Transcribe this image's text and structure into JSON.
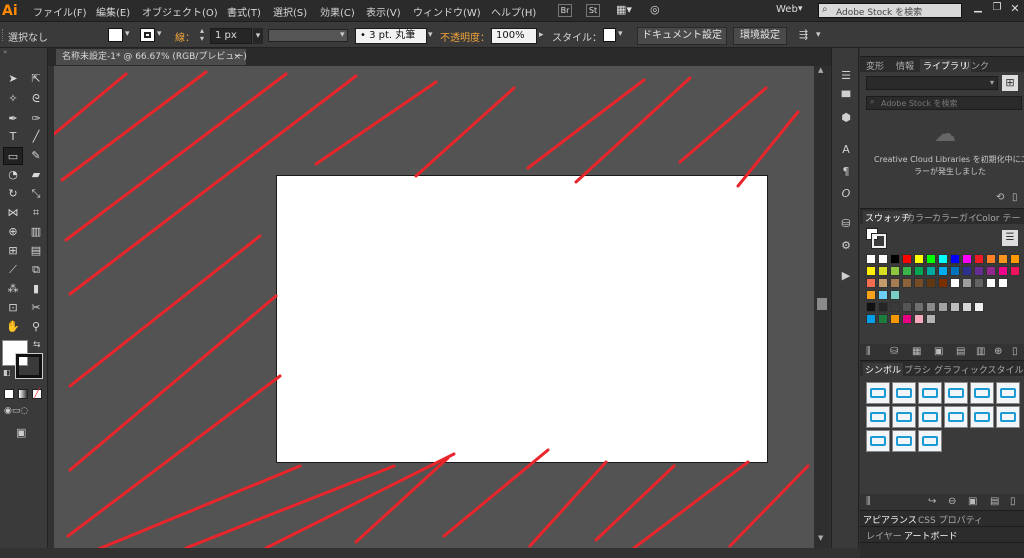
{
  "app": {
    "logo": "Ai"
  },
  "menubar": {
    "items": [
      "ファイル(F)",
      "編集(E)",
      "オブジェクト(O)",
      "書式(T)",
      "選択(S)",
      "効果(C)",
      "表示(V)",
      "ウィンドウ(W)",
      "ヘルプ(H)"
    ],
    "bridge_label": "Br",
    "stock_label": "St",
    "workspace": "Web",
    "search_placeholder": "Adobe Stock を検索"
  },
  "control_bar": {
    "selection_label": "選択なし",
    "stroke_label": "線：",
    "stroke_width": "1 px",
    "brush_label": "3 pt. 丸筆",
    "opacity_label": "不透明度：",
    "opacity_value": "100%",
    "style_label": "スタイル：",
    "doc_settings_button": "ドキュメント設定",
    "env_settings_button": "環境設定"
  },
  "document": {
    "tab_title": "名称未設定-1* @ 66.67% (RGB/プレビュー)",
    "close_symbol": "×"
  },
  "panels": {
    "top_tabs": [
      "変形",
      "情報",
      "ライブラリ",
      "リンク"
    ],
    "top_active": "ライブラリ",
    "library_search_placeholder": "Adobe Stock を検索",
    "library_message_line1": "Creative Cloud Libraries を初期化中にエ",
    "library_message_line2": "ラーが発生しました",
    "swatch_tabs": [
      "スウォッチ",
      "カラー",
      "カラーガイ",
      "Color テー"
    ],
    "swatch_active": "スウォッチ",
    "symbol_tabs": [
      "シンボル",
      "ブラシ",
      "グラフィックスタイル"
    ],
    "symbol_active": "シンボル",
    "appearance_tabs": [
      "アピアランス",
      "CSS プロパティ"
    ],
    "appearance_active": "アピアランス",
    "layer_tabs": [
      "レイヤー",
      "アートボード"
    ],
    "layer_active": "アートボード"
  },
  "colors": {
    "stroke_red": "#e8252a",
    "artboard": "#ffffff",
    "pasteboard": "#535353",
    "accent_orange": "#ff8a00"
  },
  "swatches": [
    [
      "#ffffff",
      "#ffffff",
      "#000000",
      "#ff0000",
      "#ffff00",
      "#00ff00",
      "#00ffff",
      "#0000ff",
      "#ff00ff",
      "#ed1c24",
      "#ff7f27",
      "#f7941d",
      "#ff9900"
    ],
    [
      "#fff200",
      "#d7df23",
      "#8dc63f",
      "#39b54a",
      "#00a651",
      "#00a99d",
      "#00aeef",
      "#0072bc",
      "#2e3192",
      "#662d91",
      "#92278f",
      "#ec008c",
      "#ed145b"
    ],
    [
      "#f26c4f",
      "#c69c6d",
      "#a67c52",
      "#8c6239",
      "#754c24",
      "#603913",
      "#7b2e00",
      "#ffffff",
      "#9e9e9e",
      "#636363",
      "#ffffff",
      "#ffffff"
    ],
    [
      "#f9a11b",
      "#6dcff6",
      "#7accc8"
    ],
    [
      "#111111",
      "#262626",
      "#3a3a3a",
      "#555555",
      "#707070",
      "#8a8a8a",
      "#a3a3a3",
      "#bcbcbc",
      "#d6d6d6",
      "#efefef"
    ],
    [
      "#00a0e9",
      "#1d7d3e",
      "#f39800",
      "#e4007f",
      "#f5a9bc",
      "#b3b3b3"
    ]
  ],
  "symbols": [
    "rule-1",
    "rule-2",
    "rule-3",
    "rule-4",
    "dropdown",
    "close",
    "calendar",
    "media",
    "rss",
    "magnifier",
    "card",
    "cart",
    "home",
    "heart-plus",
    "printer"
  ]
}
